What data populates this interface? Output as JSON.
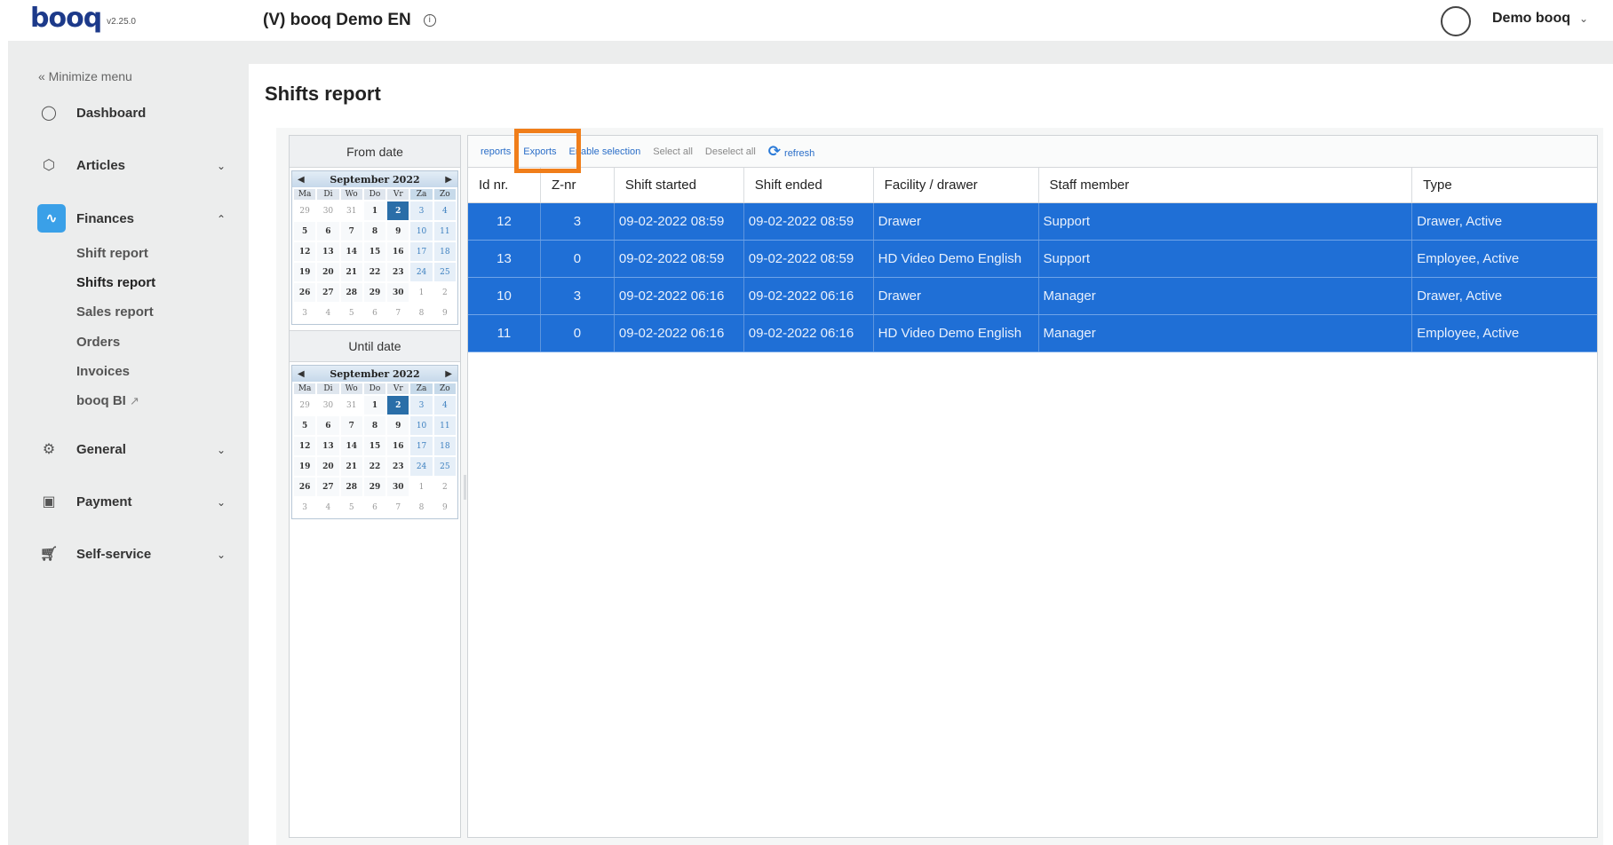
{
  "header": {
    "logo": "booq",
    "version": "v2.25.0",
    "venue": "(V) booq Demo EN",
    "info_icon": "info-icon",
    "user_name": "Demo booq"
  },
  "sidebar": {
    "minimize": "« Minimize menu",
    "items": [
      {
        "label": "Dashboard",
        "icon": "compass-icon"
      },
      {
        "label": "Articles",
        "icon": "box-icon"
      },
      {
        "label": "Finances",
        "icon": "activity-icon"
      },
      {
        "label": "General",
        "icon": "gear-icon"
      },
      {
        "label": "Payment",
        "icon": "card-icon"
      },
      {
        "label": "Self-service",
        "icon": "cart-icon"
      }
    ],
    "finance_sub": [
      "Shift report",
      "Shifts report",
      "Sales report",
      "Orders",
      "Invoices",
      "booq BI"
    ]
  },
  "page": {
    "title": "Shifts report",
    "from_date": "From date",
    "until_date": "Until date"
  },
  "calendar": {
    "month": "September 2022",
    "weekdays": [
      "Ma",
      "Di",
      "Wo",
      "Do",
      "Vr",
      "Za",
      "Zo"
    ],
    "selected_day": "2"
  },
  "toolbar": {
    "reports": "reports",
    "exports": "Exports",
    "enable_selection": "Enable selection",
    "select_all": "Select all",
    "deselect_all": "Deselect all",
    "refresh": "refresh"
  },
  "table": {
    "columns": [
      "Id nr.",
      "Z-nr",
      "Shift started",
      "Shift ended",
      "Facility / drawer",
      "Staff member",
      "Type"
    ],
    "rows": [
      [
        "12",
        "3",
        "09-02-2022 08:59",
        "09-02-2022 08:59",
        "Drawer",
        "Support",
        "Drawer, Active"
      ],
      [
        "13",
        "0",
        "09-02-2022 08:59",
        "09-02-2022 08:59",
        "HD Video Demo English",
        "Support",
        "Employee, Active"
      ],
      [
        "10",
        "3",
        "09-02-2022 06:16",
        "09-02-2022 06:16",
        "Drawer",
        "Manager",
        "Drawer, Active"
      ],
      [
        "11",
        "0",
        "09-02-2022 06:16",
        "09-02-2022 06:16",
        "HD Video Demo English",
        "Manager",
        "Employee, Active"
      ]
    ]
  },
  "colors": {
    "accent": "#1f6fd6",
    "highlight": "#f07e1a",
    "finance_icon": "#3aa0e8"
  }
}
